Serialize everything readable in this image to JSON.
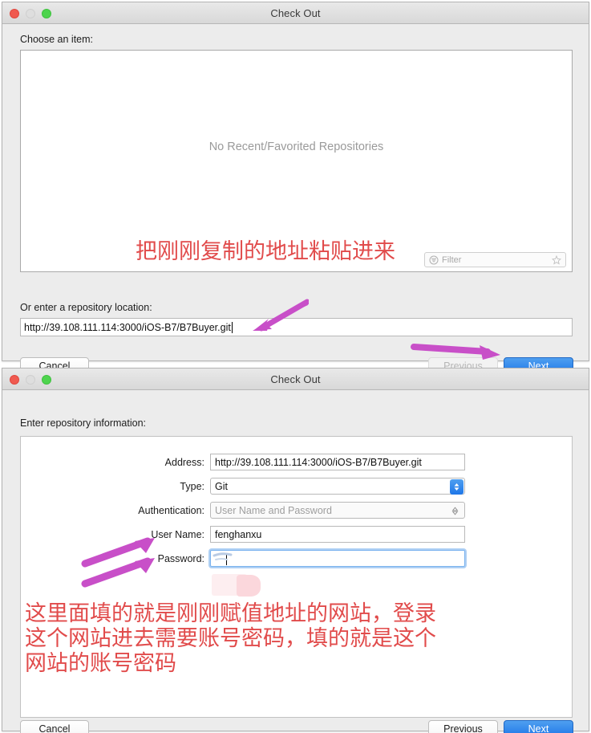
{
  "window1": {
    "title": "Check Out",
    "traffic_lights": [
      "close-button",
      "minimize-button",
      "zoom-button"
    ],
    "choose_label": "Choose an item:",
    "empty_message": "No Recent/Favorited Repositories",
    "filter": {
      "placeholder": "Filter",
      "icon": "filter-icon",
      "favorite_icon": "star-icon"
    },
    "location_label": "Or enter a repository location:",
    "location_value": "http://39.108.111.114:3000/iOS-B7/B7Buyer.git",
    "buttons": {
      "cancel": "Cancel",
      "previous": "Previous",
      "next": "Next"
    },
    "annotation": "把刚刚复制的地址粘贴进来"
  },
  "window2": {
    "title": "Check Out",
    "traffic_lights": [
      "close-button",
      "minimize-button",
      "zoom-button"
    ],
    "header_label": "Enter repository information:",
    "fields": [
      {
        "label": "Address:",
        "value": "http://39.108.111.114:3000/iOS-B7/B7Buyer.git",
        "kind": "text"
      },
      {
        "label": "Type:",
        "value": "Git",
        "kind": "popup"
      },
      {
        "label": "Authentication:",
        "value": "User Name and Password",
        "kind": "popup-muted"
      },
      {
        "label": "User Name:",
        "value": "fenghanxu",
        "kind": "text"
      },
      {
        "label": "Password:",
        "value": "",
        "kind": "password-focused"
      }
    ],
    "buttons": {
      "cancel": "Cancel",
      "previous": "Previous",
      "next": "Next"
    },
    "annotation": "这里面填的就是刚刚赋值地址的网站，登录\n这个网站进去需要账号密码，填的就是这个\n网站的账号密码"
  },
  "colors": {
    "annotation_red": "#e14b4b",
    "arrow_magenta": "#c84fc8",
    "primary_blue": "#1e76e8",
    "dialog_gray": "#ececec"
  }
}
